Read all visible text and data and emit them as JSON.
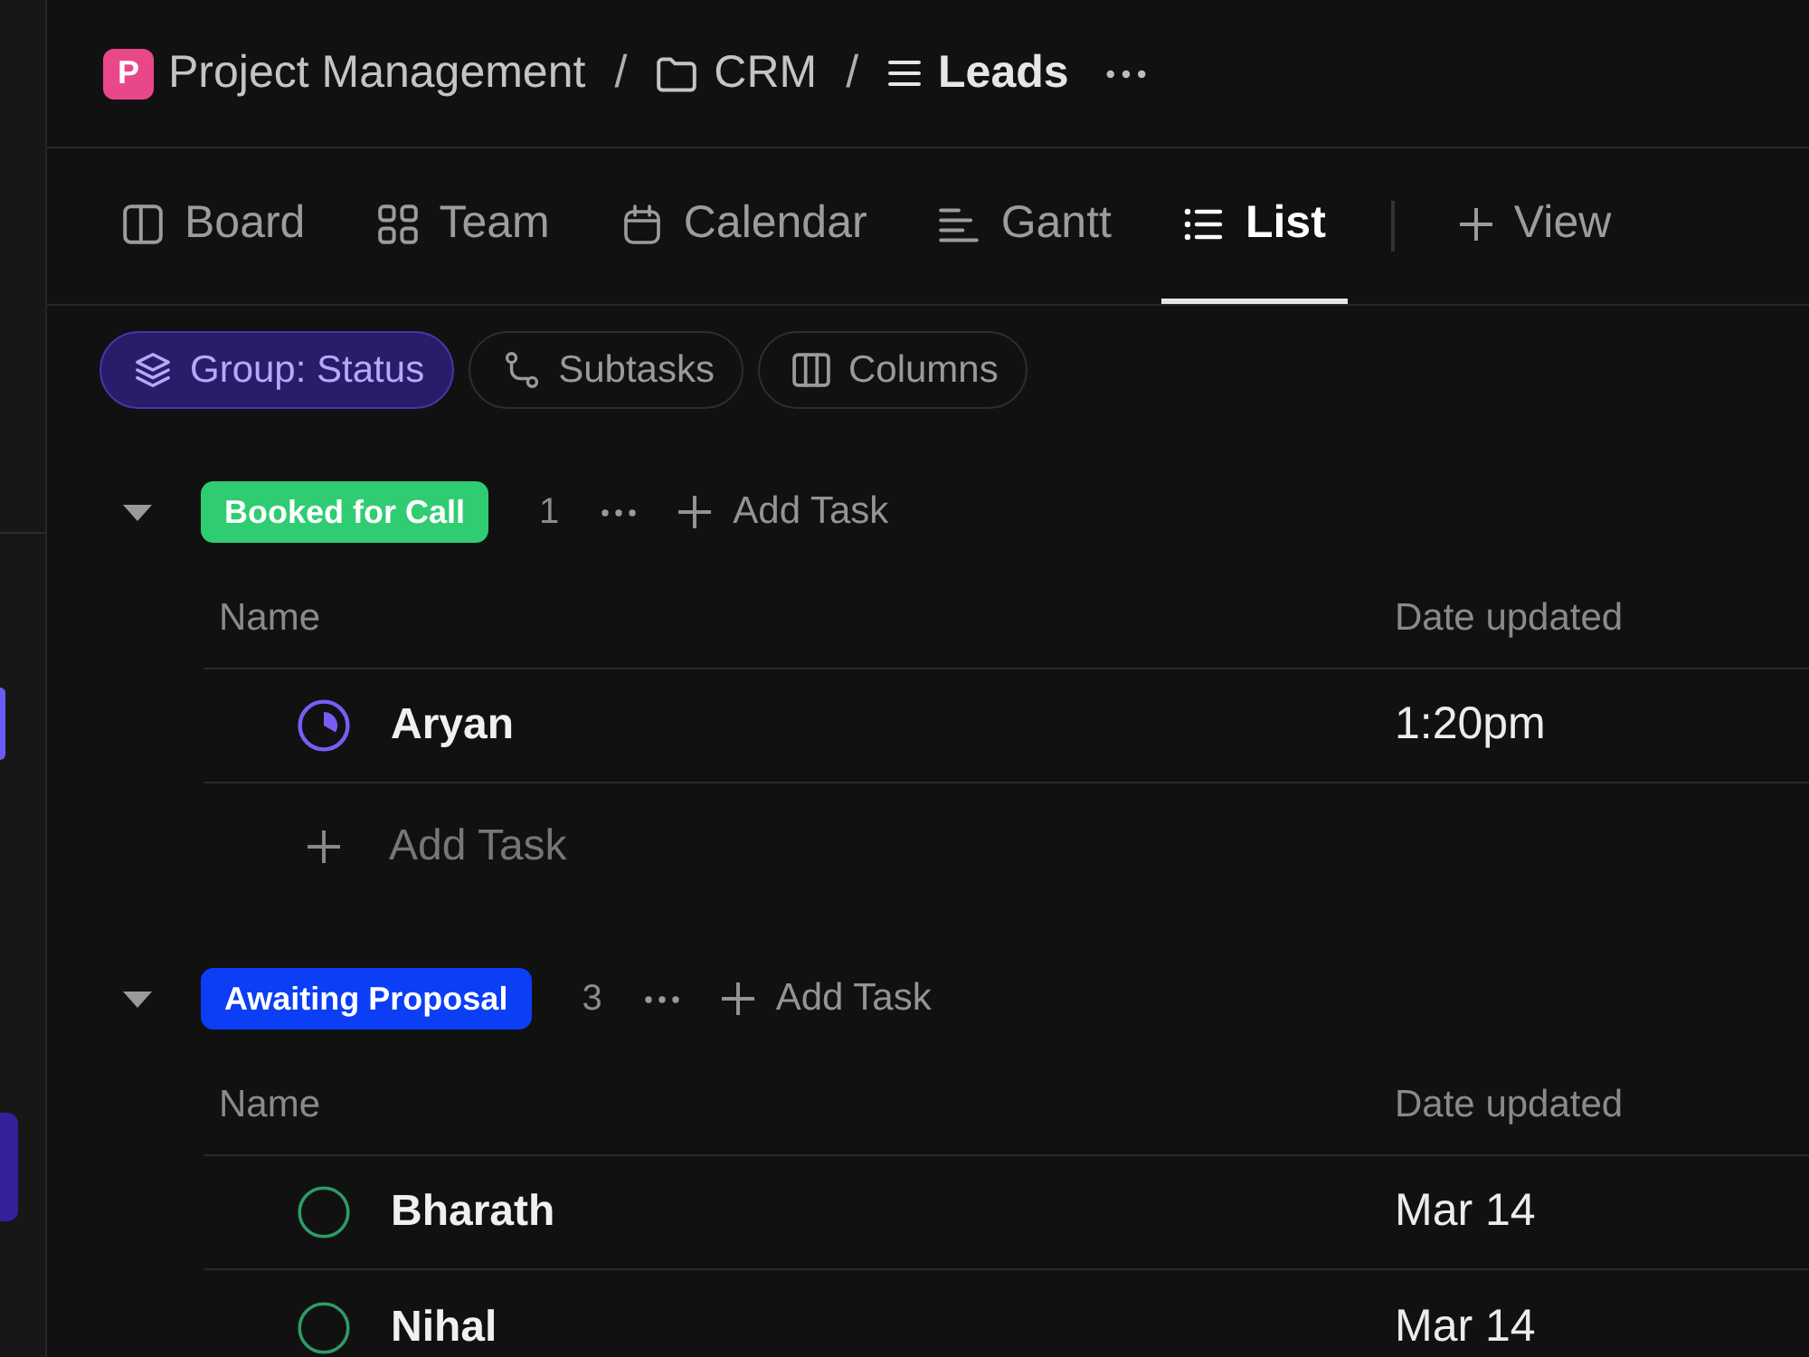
{
  "breadcrumb": [
    {
      "kind": "space",
      "initial": "P",
      "label": "Project Management",
      "current": false
    },
    {
      "kind": "folder",
      "separator": "/",
      "label": "CRM",
      "current": false
    },
    {
      "kind": "list",
      "separator": "/",
      "label": "Leads",
      "current": true
    }
  ],
  "view_tabs": [
    {
      "kind": "board",
      "label": "Board",
      "selected": false
    },
    {
      "kind": "team",
      "label": "Team",
      "selected": false
    },
    {
      "kind": "calendar",
      "label": "Calendar",
      "selected": false
    },
    {
      "kind": "gantt",
      "label": "Gantt",
      "selected": false
    },
    {
      "kind": "list",
      "label": "List",
      "selected": true
    }
  ],
  "add_view": "View",
  "toolbar_chips": [
    {
      "kind": "group",
      "label": "Group: Status",
      "on": true
    },
    {
      "kind": "subtasks",
      "label": "Subtasks",
      "on": false
    },
    {
      "kind": "columns",
      "label": "Columns",
      "on": false
    }
  ],
  "groups": [
    {
      "status": "Booked for Call",
      "color": "#2fcc71",
      "count": "1",
      "expanded": true,
      "add_task": "Add Task",
      "columns": [
        "Name",
        "Date updated"
      ],
      "tasks": [
        {
          "kind": "in_progress",
          "name": "Aryan",
          "date_updated": "1:20pm"
        }
      ],
      "add_task_row": "Add Task"
    },
    {
      "status": "Awaiting Proposal",
      "color": "#0b3ef5",
      "count": "3",
      "expanded": true,
      "add_task": "Add Task",
      "columns": [
        "Name",
        "Date updated"
      ],
      "tasks": [
        {
          "kind": "todo",
          "name": "Bharath",
          "date_updated": "Mar 14"
        },
        {
          "kind": "todo",
          "name": "Nihal",
          "date_updated": "Mar 14"
        }
      ]
    }
  ]
}
